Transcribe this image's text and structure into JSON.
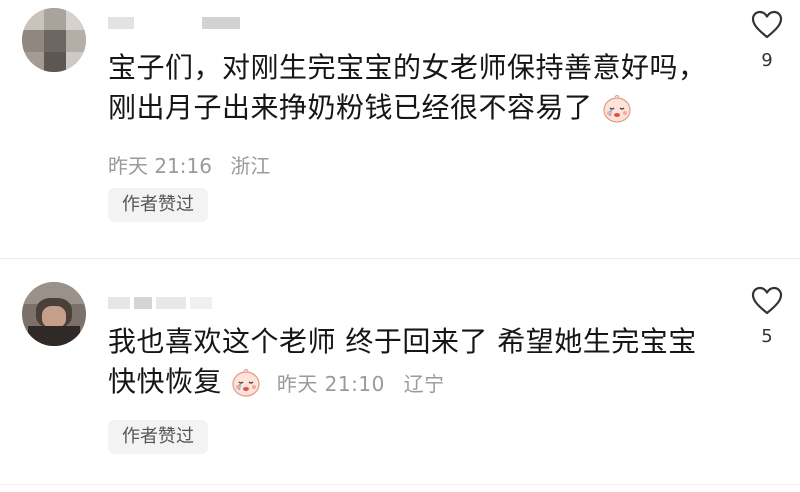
{
  "comments": [
    {
      "text_line1": "宝子们，对刚生完宝宝的女老师保持善意好吗，",
      "text_line2": "刚出月子出来挣奶粉钱已经很不容易了",
      "time": "昨天 21:16",
      "location": "浙江",
      "author_liked": "作者赞过",
      "likes": "9",
      "emoji": "crying-face-emoji"
    },
    {
      "text_line1": "我也喜欢这个老师 终于回来了 希望她生完宝宝",
      "text_line2": "快快恢复",
      "time": "昨天 21:10",
      "location": "辽宁",
      "author_liked": "作者赞过",
      "likes": "5",
      "emoji": "crying-face-emoji"
    }
  ],
  "colors": {
    "meta": "#9a9a9a",
    "pill_bg": "#f3f3f3",
    "text": "#161616"
  }
}
